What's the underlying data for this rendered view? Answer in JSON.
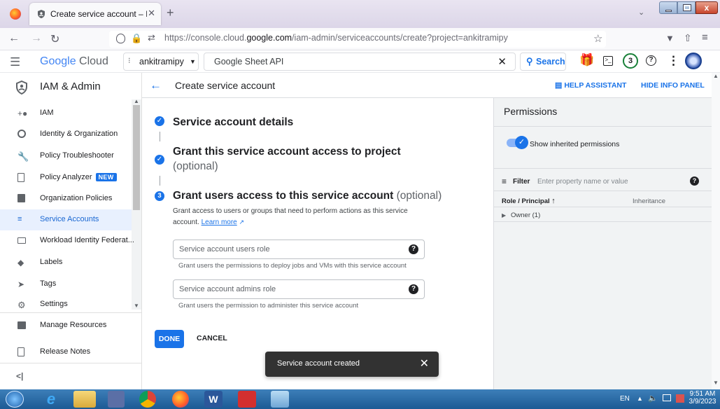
{
  "browser": {
    "tab_title": "Create service account – IAM &",
    "tab_close": "✕",
    "new_tab": "+",
    "url_prefix": "https://console.cloud.",
    "url_domain": "google.com",
    "url_suffix": "/iam-admin/serviceaccounts/create?project=ankitramipy"
  },
  "header": {
    "logo_google": "Google",
    "logo_cloud": "Cloud",
    "project": "ankitramipy",
    "search_value": "Google Sheet API",
    "search_button": "Search",
    "notifications_count": "3"
  },
  "sidebar": {
    "title": "IAM & Admin",
    "items": [
      {
        "label": "IAM",
        "icon": "person-add-icon"
      },
      {
        "label": "Identity & Organization",
        "icon": "account-circle-icon"
      },
      {
        "label": "Policy Troubleshooter",
        "icon": "wrench-icon"
      },
      {
        "label": "Policy Analyzer",
        "icon": "policy-doc-icon",
        "badge": "NEW"
      },
      {
        "label": "Organization Policies",
        "icon": "list-doc-icon"
      },
      {
        "label": "Service Accounts",
        "icon": "service-account-icon",
        "active": true
      },
      {
        "label": "Workload Identity Federat...",
        "icon": "id-card-icon"
      },
      {
        "label": "Labels",
        "icon": "label-icon"
      },
      {
        "label": "Tags",
        "icon": "tag-arrow-icon"
      },
      {
        "label": "Settings",
        "icon": "gear-icon"
      }
    ],
    "manage_resources": "Manage Resources",
    "release_notes": "Release Notes",
    "collapse": "<|"
  },
  "page": {
    "title": "Create service account",
    "help_assistant": "HELP ASSISTANT",
    "hide_info_panel": "HIDE INFO PANEL"
  },
  "steps": {
    "step1_title": "Service account details",
    "step2_title": "Grant this service account access to project",
    "step2_optional": "(optional)",
    "step3_number": "3",
    "step3_title": "Grant users access to this service account",
    "step3_optional": "(optional)",
    "step3_desc": "Grant access to users or groups that need to perform actions as this service",
    "step3_desc2": "account.",
    "learn_more": "Learn more",
    "users_role_placeholder": "Service account users role",
    "users_role_helper": "Grant users the permissions to deploy jobs and VMs with this service account",
    "admins_role_placeholder": "Service account admins role",
    "admins_role_helper": "Grant users the permission to administer this service account",
    "done": "DONE",
    "cancel": "CANCEL"
  },
  "snackbar": {
    "message": "Service account created",
    "close": "✕"
  },
  "panel": {
    "title": "Permissions",
    "toggle_label": "Show inherited permissions",
    "toggle_on": true,
    "filter_label": "Filter",
    "filter_placeholder": "Enter property name or value",
    "col_role": "Role / Principal",
    "col_inheritance": "Inheritance",
    "row_owner": "Owner (1)"
  },
  "taskbar": {
    "lang": "EN",
    "time": "9:51 AM",
    "date": "3/9/2023"
  },
  "colors": {
    "accent": "#1a73e8",
    "active_bg": "#e8f0fe",
    "snackbar": "#323232"
  }
}
